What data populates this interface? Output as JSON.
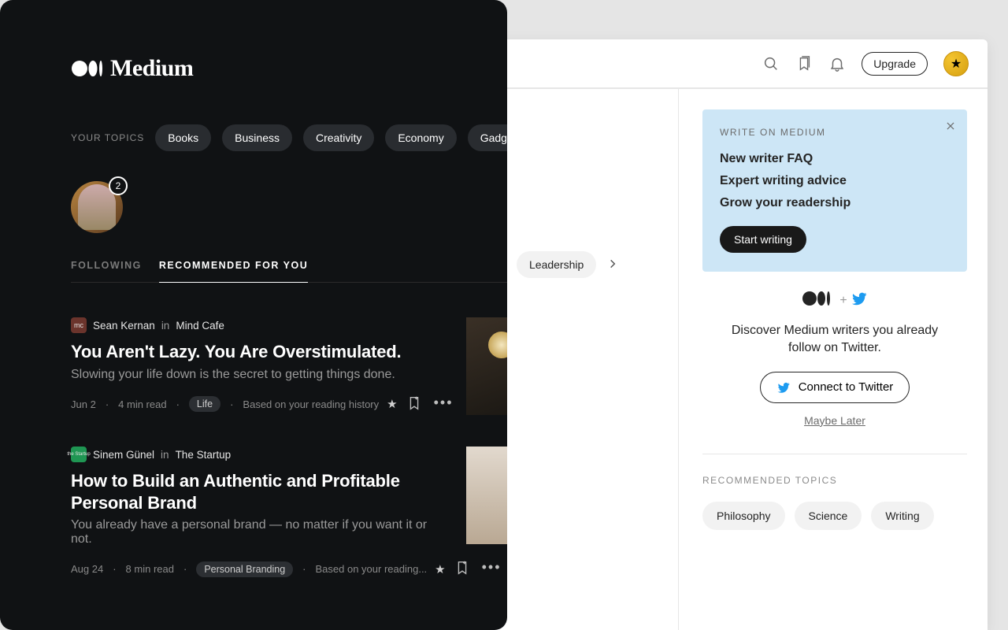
{
  "brand": "Medium",
  "header": {
    "upgrade_label": "Upgrade"
  },
  "topics_label": "YOUR TOPICS",
  "topics": [
    "Books",
    "Business",
    "Creativity",
    "Economy",
    "Gadgets",
    "Leadership"
  ],
  "follow_badge": "2",
  "tabs": {
    "following": "FOLLOWING",
    "recommended": "RECOMMENDED FOR YOU"
  },
  "articles": [
    {
      "author": "Sean Kernan",
      "in": "in",
      "publication": "Mind Cafe",
      "title": "You Aren't Lazy. You Are Overstimulated.",
      "subtitle": "Slowing your life down is the secret to getting things done.",
      "date": "Jun 2",
      "read": "4 min read",
      "tag": "Life",
      "reason": "Based on your reading history"
    },
    {
      "author": "Sinem Günel",
      "in": "in",
      "publication": "The Startup",
      "title": "How to Build an Authentic and Profitable Personal Brand",
      "subtitle": "You already have a personal brand — no matter if you want it or not.",
      "date": "Aug 24",
      "read": "8 min read",
      "tag": "Personal Branding",
      "reason": "Based on your reading..."
    }
  ],
  "sidebar": {
    "promo_label": "WRITE ON MEDIUM",
    "promo_links": [
      "New writer FAQ",
      "Expert writing advice",
      "Grow your readership"
    ],
    "start_writing": "Start writing",
    "twitter_desc": "Discover Medium writers you already follow on Twitter.",
    "connect_label": "Connect to Twitter",
    "maybe_later": "Maybe Later",
    "rec_label": "RECOMMENDED TOPICS",
    "rec_topics": [
      "Philosophy",
      "Science",
      "Writing"
    ]
  }
}
